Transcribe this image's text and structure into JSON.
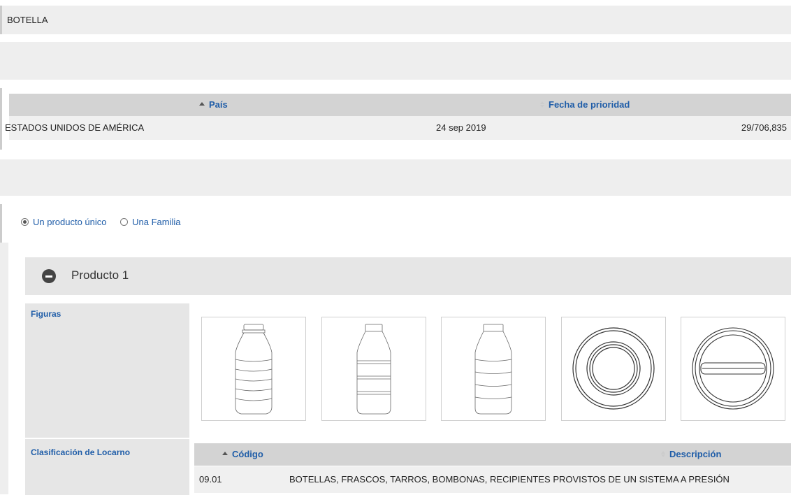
{
  "title": "BOTELLA",
  "priority": {
    "headers": {
      "country": "País",
      "date": "Fecha de prioridad"
    },
    "row": {
      "country": "ESTADOS UNIDOS DE AMÉRICA",
      "date": "24 sep 2019",
      "number": "29/706,835"
    }
  },
  "radio": {
    "single": "Un producto único",
    "family": "Una Familia",
    "selected": "single"
  },
  "product": {
    "title": "Producto 1",
    "figures_label": "Figuras",
    "figures": [
      "bottle-front-view",
      "bottle-side-view",
      "bottle-back-view",
      "bottle-bottom-view",
      "bottle-top-view"
    ],
    "locarno_label": "Clasificación de Locarno",
    "locarno": {
      "headers": {
        "code": "Código",
        "description": "Descripción"
      },
      "row": {
        "code": "09.01",
        "description": "BOTELLAS, FRASCOS, TARROS, BOMBONAS, RECIPIENTES PROVISTOS DE UN SISTEMA A PRESIÓN"
      }
    }
  },
  "colors": {
    "link": "#1f5da8",
    "header_bg": "#d3d3d3",
    "band_bg": "#eeeeee"
  }
}
